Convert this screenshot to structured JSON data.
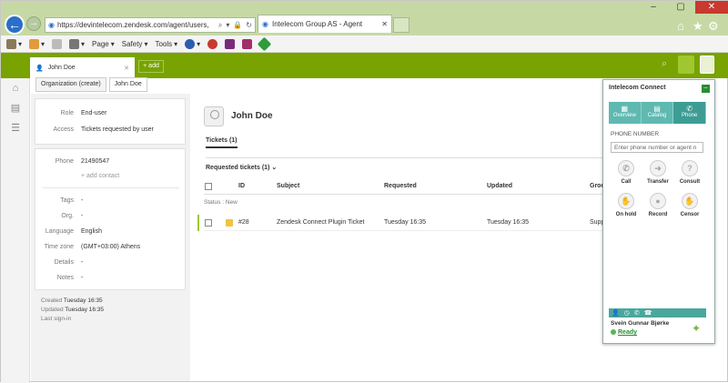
{
  "browser": {
    "url": "https://devintelecom.zendesk.com/agent/users,",
    "tab_title": "Intelecom Group AS - Agent",
    "toolbar": [
      "Page",
      "Safety",
      "Tools"
    ]
  },
  "zendesk": {
    "open_tab": "John Doe",
    "add_label": "+ add",
    "breadcrumbs": [
      "Organization (create)",
      "John Doe"
    ]
  },
  "user_card": {
    "role_label": "Role",
    "role": "End-user",
    "access_label": "Access",
    "access": "Tickets requested by user",
    "phone_label": "Phone",
    "phone": "21490547",
    "add_contact": "+ add contact",
    "tags_label": "Tags",
    "tags": "-",
    "org_label": "Org.",
    "org": "-",
    "language_label": "Language",
    "language": "English",
    "timezone_label": "Time zone",
    "timezone": "(GMT+03:00) Athens",
    "details_label": "Details",
    "details": "-",
    "notes_label": "Notes",
    "notes": "-"
  },
  "meta": {
    "created_label": "Created",
    "created": "Tuesday 16:35",
    "updated_label": "Updated",
    "updated": "Tuesday 16:35",
    "last_signin_label": "Last sign-in"
  },
  "main": {
    "user_name": "John Doe",
    "tab_tickets": "Tickets (1)",
    "requested": "Requested tickets (1) ⌄",
    "columns": [
      "ID",
      "Subject",
      "Requested",
      "Updated",
      "Grou"
    ],
    "status_group": "Status : New",
    "ticket": {
      "id": "#28",
      "subject": "Zendesk Connect Plugin Ticket",
      "requested": "Tuesday 16:35",
      "updated": "Tuesday 16:35",
      "group": "Supp"
    }
  },
  "connect": {
    "title": "Intelecom Connect",
    "tabs": [
      "Overview",
      "Catalog",
      "Phone"
    ],
    "phone_number_label": "PHONE NUMBER",
    "phone_placeholder": "Enter phone number or agent n",
    "buttons": [
      "Call",
      "Transfer",
      "Consult",
      "On hold",
      "Record",
      "Censor"
    ],
    "agent_name": "Svein Gunnar Bjørke",
    "status": "Ready"
  },
  "colors": {
    "zendesk_green": "#78a300",
    "connect_teal": "#4aa79e",
    "ready_green": "#2a8c34"
  }
}
